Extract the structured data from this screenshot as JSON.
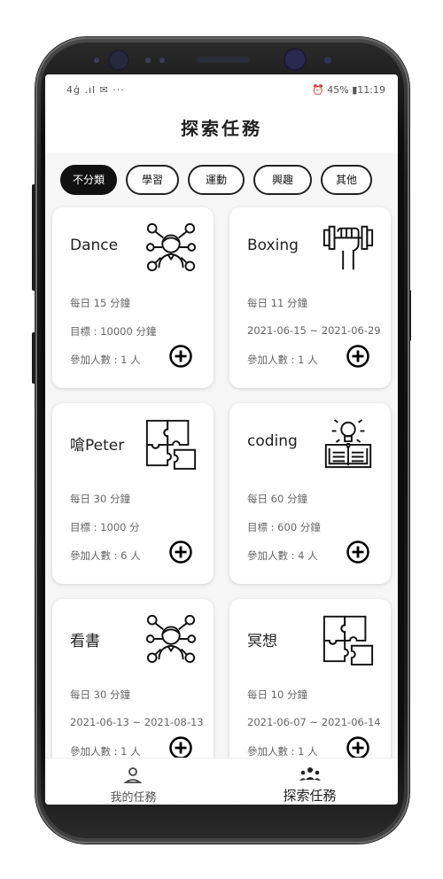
{
  "status_bar": {
    "left": "4ǵ .ıl ✉ ···",
    "right": "⏰ 45% ▮11:19"
  },
  "header": {
    "title": "探索任務"
  },
  "categories": [
    {
      "label": "不分類",
      "active": true
    },
    {
      "label": "學習",
      "active": false
    },
    {
      "label": "運動",
      "active": false
    },
    {
      "label": "興趣",
      "active": false
    },
    {
      "label": "其他",
      "active": false
    }
  ],
  "tasks": [
    {
      "name": "Dance",
      "icon": "person-network-icon",
      "line1": "每日 15 分鐘",
      "line2": "目標 : 10000 分鐘",
      "line3": "參加人數 : 1 人"
    },
    {
      "name": "Boxing",
      "icon": "dumbbell-hand-icon",
      "line1": "每日 11 分鐘",
      "line2": "2021-06-15 ~ 2021-06-29",
      "line3": "參加人數 : 1 人"
    },
    {
      "name": "嗆Peter",
      "icon": "puzzle-icon",
      "line1": "每日 30 分鐘",
      "line2": "目標 : 1000 分",
      "line3": "參加人數 : 6 人"
    },
    {
      "name": "coding",
      "icon": "book-lightbulb-icon",
      "line1": "每日 60 分鐘",
      "line2": "目標 : 600 分鐘",
      "line3": "參加人數 : 4 人"
    },
    {
      "name": "看書",
      "icon": "person-network-icon",
      "line1": "每日 30 分鐘",
      "line2": "2021-06-13 ~ 2021-08-13",
      "line3": "參加人數 : 1 人"
    },
    {
      "name": "冥想",
      "icon": "puzzle-icon",
      "line1": "每日 10 分鐘",
      "line2": "2021-06-07 ~ 2021-06-14",
      "line3": "參加人數 : 1 人"
    }
  ],
  "tabs": [
    {
      "label": "我的任務",
      "icon": "person-icon",
      "active": false
    },
    {
      "label": "探索任務",
      "icon": "group-icon",
      "active": true
    }
  ]
}
